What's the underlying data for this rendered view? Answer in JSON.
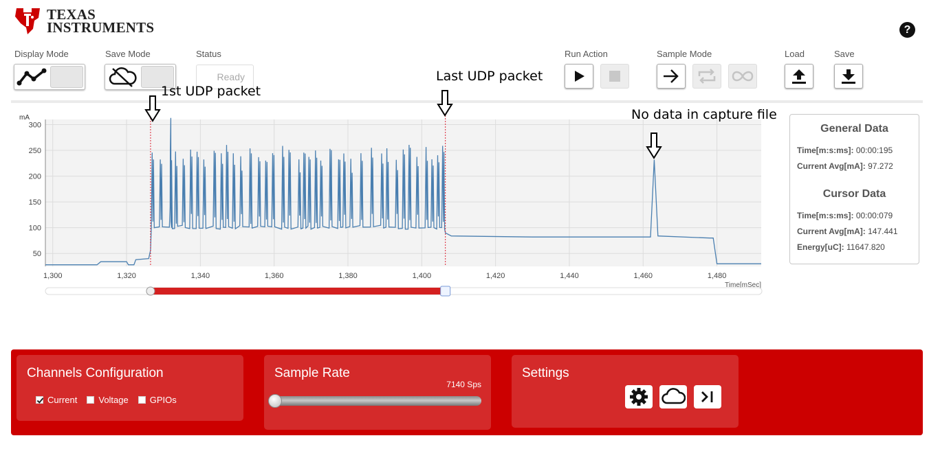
{
  "header": {
    "brand_line1": "TEXAS",
    "brand_line2": "INSTRUMENTS",
    "help_icon": "question-circle-icon"
  },
  "toolbar": {
    "display_mode_label": "Display Mode",
    "save_mode_label": "Save Mode",
    "status_label": "Status",
    "status_value": "Ready",
    "run_action_label": "Run Action",
    "sample_mode_label": "Sample Mode",
    "load_label": "Load",
    "save_label": "Save"
  },
  "annotations": {
    "first_packet": "1st UDP packet",
    "last_packet": "Last UDP packet",
    "no_data": "No data in capture file"
  },
  "chart_data": {
    "type": "line",
    "ylabel": "mA",
    "xlabel": "Time[mSec]",
    "xlim": [
      1298,
      1492
    ],
    "ylim": [
      25,
      310
    ],
    "x_ticks": [
      "1,300",
      "1,320",
      "1,340",
      "1,360",
      "1,380",
      "1,400",
      "1,420",
      "1,440",
      "1,460",
      "1,480"
    ],
    "x_tick_values": [
      1300,
      1320,
      1340,
      1360,
      1380,
      1400,
      1420,
      1440,
      1460,
      1480
    ],
    "y_ticks": [
      "50",
      "100",
      "150",
      "200",
      "250",
      "300"
    ],
    "y_tick_values": [
      50,
      100,
      150,
      200,
      250,
      300
    ],
    "cursor_start_ms": 1326.5,
    "cursor_end_ms": 1406.4,
    "line_color": "#4a7fb0",
    "cursor_color": "#dd2233",
    "series": [
      {
        "baseline_segments": [
          [
            1298,
            28
          ],
          [
            1312,
            28
          ],
          [
            1313,
            34
          ],
          [
            1320,
            34
          ],
          [
            1320.5,
            28
          ],
          [
            1322,
            28
          ],
          [
            1322.5,
            38
          ],
          [
            1326,
            40
          ],
          [
            1326.5,
            56
          ]
        ],
        "burst_region": [
          1326.5,
          1406.4
        ],
        "burst_low": 97,
        "burst_high": [
          230,
          262
        ],
        "peak": [
          1332,
          314
        ],
        "tail_segments": [
          [
            1406.4,
            90
          ],
          [
            1408,
            84
          ],
          [
            1430,
            82
          ],
          [
            1462,
            82
          ],
          [
            1463,
            232
          ],
          [
            1464,
            84
          ],
          [
            1478,
            80
          ],
          [
            1479,
            80
          ],
          [
            1480,
            30
          ],
          [
            1492,
            30
          ]
        ]
      }
    ]
  },
  "general_data": {
    "title": "General Data",
    "time_label": "Time[m:s:ms]:",
    "time_value": "00:00:195",
    "current_label": "Current Avg[mA]:",
    "current_value": "97.272"
  },
  "cursor_data": {
    "title": "Cursor Data",
    "time_label": "Time[m:s:ms]:",
    "time_value": "00:00:079",
    "current_label": "Current Avg[mA]:",
    "current_value": "147.441",
    "energy_label": "Energy[uC]:",
    "energy_value": "11647.820"
  },
  "footer": {
    "channels_title": "Channels Configuration",
    "channels": [
      {
        "label": "Current",
        "checked": true
      },
      {
        "label": "Voltage",
        "checked": false
      },
      {
        "label": "GPIOs",
        "checked": false
      }
    ],
    "rate_title": "Sample Rate",
    "rate_value": "7140 Sps",
    "rate_fraction": 0.0,
    "settings_title": "Settings",
    "settings_icons": [
      "gear-icon",
      "cloud-icon",
      "jump-to-end-icon"
    ]
  },
  "colors": {
    "brand_red": "#cc0000",
    "card_red": "#d42a2a",
    "accent_red": "#d42020"
  }
}
